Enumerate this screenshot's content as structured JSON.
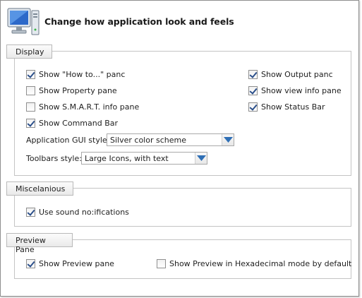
{
  "header": {
    "title": "Change how application look and feels",
    "icon": "computer-monitor-icon"
  },
  "display": {
    "section_label": "Display",
    "show_howto": {
      "label": "Show \"How to...\" panc",
      "checked": true
    },
    "show_property": {
      "label": "Show Property pane",
      "checked": false
    },
    "show_smart": {
      "label": "Show S.M.A.R.T. info pane",
      "checked": false
    },
    "show_command": {
      "label": "Show Command Bar",
      "checked": true
    },
    "show_output": {
      "label": "Show Output panc",
      "checked": true
    },
    "show_viewinfo": {
      "label": "Show view info pane",
      "checked": true
    },
    "show_status": {
      "label": "Show Status Bar",
      "checked": true
    },
    "gui_style_label": "Application GUI style:",
    "gui_style_value": "Silver color scheme",
    "toolbar_style_label": "Toolbars style:",
    "toolbar_style_value": "Large Icons, with text"
  },
  "misc": {
    "section_label": "Miscelanious",
    "use_sound": {
      "label": "Use sound no:ifications",
      "checked": true
    }
  },
  "preview": {
    "section_label": "Preview Pane",
    "show_preview": {
      "label": "Show Preview pane",
      "checked": true
    },
    "show_hex": {
      "label": "Show Preview in Hexadecimal mode by default",
      "checked": false
    }
  },
  "colors": {
    "dropdown_arrow": "#2f6fb5",
    "check": "#2b4f8a"
  }
}
